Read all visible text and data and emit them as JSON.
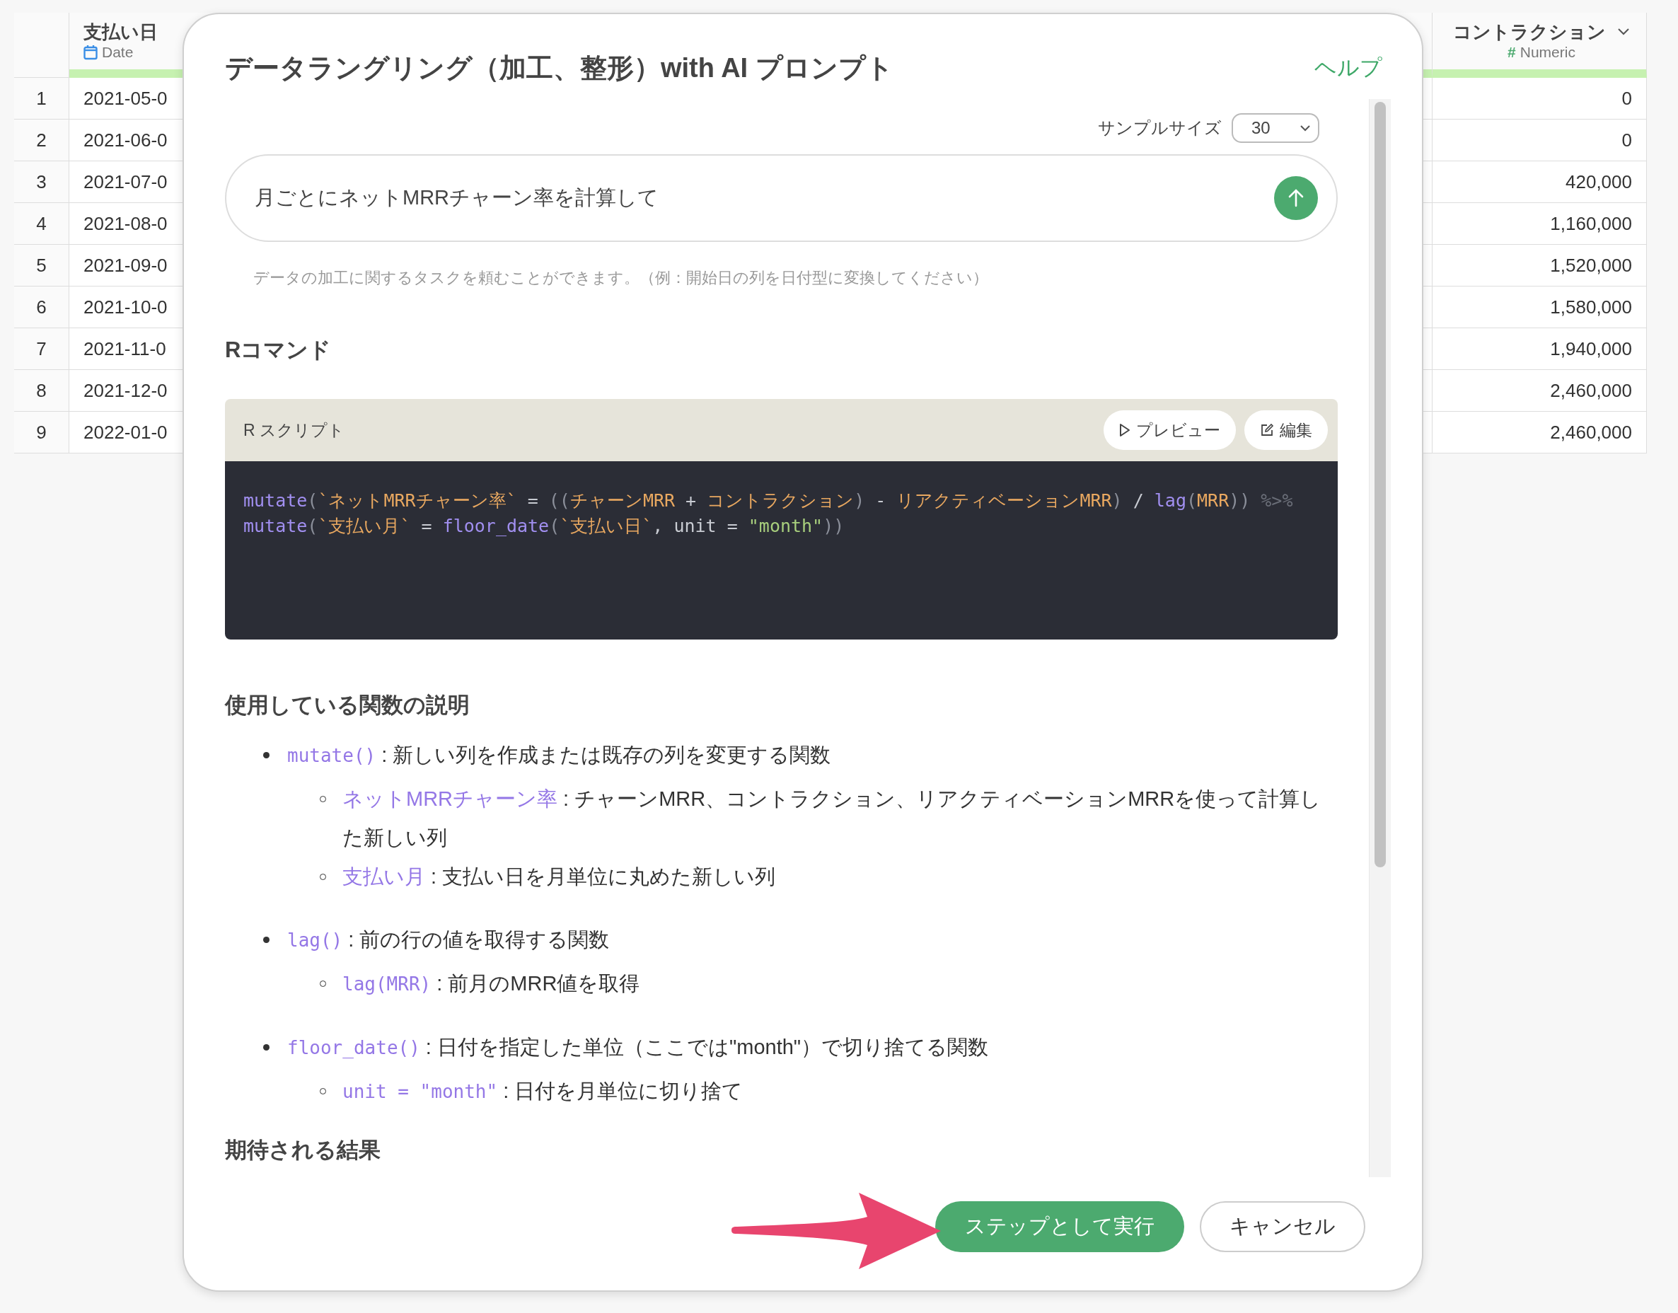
{
  "table": {
    "columns": [
      {
        "name": "支払い日",
        "kind": "date",
        "type": "Date"
      },
      {
        "name": "コントラクション",
        "kind": "numeric",
        "type_mark": "#",
        "type": "Numeric"
      }
    ],
    "rows": [
      {
        "index": "1",
        "date": "2021-05-0",
        "contraction": "0"
      },
      {
        "index": "2",
        "date": "2021-06-0",
        "contraction": "0"
      },
      {
        "index": "3",
        "date": "2021-07-0",
        "contraction": "420,000"
      },
      {
        "index": "4",
        "date": "2021-08-0",
        "contraction": "1,160,000"
      },
      {
        "index": "5",
        "date": "2021-09-0",
        "contraction": "1,520,000"
      },
      {
        "index": "6",
        "date": "2021-10-0",
        "contraction": "1,580,000"
      },
      {
        "index": "7",
        "date": "2021-11-0",
        "contraction": "1,940,000"
      },
      {
        "index": "8",
        "date": "2021-12-0",
        "contraction": "2,460,000"
      },
      {
        "index": "9",
        "date": "2022-01-0",
        "contraction": "2,460,000"
      }
    ]
  },
  "dialog": {
    "title": "データラングリング（加工、整形）with AI プロンプト",
    "help": "ヘルプ",
    "sample_size": {
      "label": "サンプルサイズ",
      "value": "30"
    },
    "prompt": {
      "value": "月ごとにネットMRRチャーン率を計算して",
      "help_text": "データの加工に関するタスクを頼むことができます。（例：開始日の列を日付型に変換してください）"
    },
    "r_command_heading": "Rコマンド",
    "script": {
      "title": "R スクリプト",
      "buttons": [
        {
          "kind": "preview",
          "label": "プレビュー"
        },
        {
          "kind": "edit",
          "label": "編集"
        }
      ],
      "lines": [
        [
          {
            "kind": "fn",
            "text": "mutate"
          },
          {
            "kind": "punct",
            "text": "("
          },
          {
            "kind": "str",
            "text": "`ネットMRRチャーン率`"
          },
          {
            "kind": "plain",
            "text": " = "
          },
          {
            "kind": "punct",
            "text": "(("
          },
          {
            "kind": "str",
            "text": "チャーンMRR"
          },
          {
            "kind": "plain",
            "text": " + "
          },
          {
            "kind": "str",
            "text": "コントラクション"
          },
          {
            "kind": "punct",
            "text": ")"
          },
          {
            "kind": "plain",
            "text": " - "
          },
          {
            "kind": "str",
            "text": "リアクティベーションMRR"
          },
          {
            "kind": "punct",
            "text": ")"
          },
          {
            "kind": "plain",
            "text": " / "
          },
          {
            "kind": "fn",
            "text": "lag"
          },
          {
            "kind": "punct",
            "text": "("
          },
          {
            "kind": "str",
            "text": "MRR"
          },
          {
            "kind": "punct",
            "text": "))"
          },
          {
            "kind": "pipe",
            "text": "%>%"
          }
        ],
        [
          {
            "kind": "fn",
            "text": "mutate"
          },
          {
            "kind": "punct",
            "text": "("
          },
          {
            "kind": "str",
            "text": "`支払い月`"
          },
          {
            "kind": "plain",
            "text": " = "
          },
          {
            "kind": "fn",
            "text": "floor_date"
          },
          {
            "kind": "punct",
            "text": "("
          },
          {
            "kind": "str",
            "text": "`支払い日`"
          },
          {
            "kind": "plain",
            "text": ", unit = "
          },
          {
            "kind": "literal",
            "text": "\"month\""
          },
          {
            "kind": "punct",
            "text": "))"
          }
        ]
      ]
    },
    "functions_heading": "使用している関数の説明",
    "functions": [
      {
        "code": "mutate()",
        "text": ": 新しい列を作成または既存の列を変更する関数",
        "children": [
          {
            "code": "ネットMRRチャーン率",
            "text": ": チャーンMRR、コントラクション、リアクティベーションMRRを使って計算した新しい列"
          },
          {
            "code": "支払い月",
            "text": ": 支払い日を月単位に丸めた新しい列"
          }
        ]
      },
      {
        "code": "lag()",
        "text": ": 前の行の値を取得する関数",
        "children": [
          {
            "code": "lag(MRR)",
            "text": ": 前月のMRR値を取得"
          }
        ]
      },
      {
        "code": "floor_date()",
        "text": ": 日付を指定した単位（ここでは\"month\"）で切り捨てる関数",
        "children": [
          {
            "code": "unit = \"month\"",
            "text": ": 日付を月単位に切り捨て"
          }
        ]
      }
    ],
    "expected_heading": "期待される結果",
    "buttons": [
      {
        "kind": "primary",
        "label": "ステップとして実行"
      },
      {
        "kind": "secondary",
        "label": "キャンセル"
      }
    ]
  }
}
